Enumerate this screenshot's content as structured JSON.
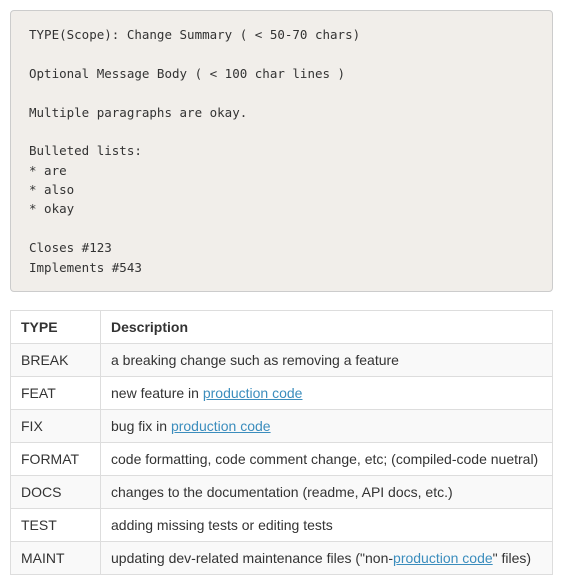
{
  "code_block": {
    "line1": "TYPE(Scope): Change Summary ( < 50-70 chars)",
    "line2": "Optional Message Body ( < 100 char lines )",
    "line3": "Multiple paragraphs are okay.",
    "line4": "Bulleted lists:",
    "bullets": [
      "* are",
      "* also",
      "* okay"
    ],
    "line5": "Closes #123",
    "line6": "Implements #543"
  },
  "table": {
    "headers": {
      "type": "TYPE",
      "desc": "Description"
    },
    "rows": [
      {
        "type": "BREAK",
        "desc_pre": "a breaking change such as removing a feature",
        "link": "",
        "desc_post": ""
      },
      {
        "type": "FEAT",
        "desc_pre": "new feature in ",
        "link": "production code",
        "desc_post": ""
      },
      {
        "type": "FIX",
        "desc_pre": "bug fix in ",
        "link": "production code",
        "desc_post": ""
      },
      {
        "type": "FORMAT",
        "desc_pre": "code formatting, code comment change, etc; (compiled-code nuetral)",
        "link": "",
        "desc_post": ""
      },
      {
        "type": "DOCS",
        "desc_pre": "changes to the documentation (readme, API docs, etc.)",
        "link": "",
        "desc_post": ""
      },
      {
        "type": "TEST",
        "desc_pre": "adding missing tests or editing tests",
        "link": "",
        "desc_post": ""
      },
      {
        "type": "MAINT",
        "desc_pre": "updating dev-related maintenance files (\"non-",
        "link": "production code",
        "desc_post": "\" files)"
      }
    ]
  }
}
